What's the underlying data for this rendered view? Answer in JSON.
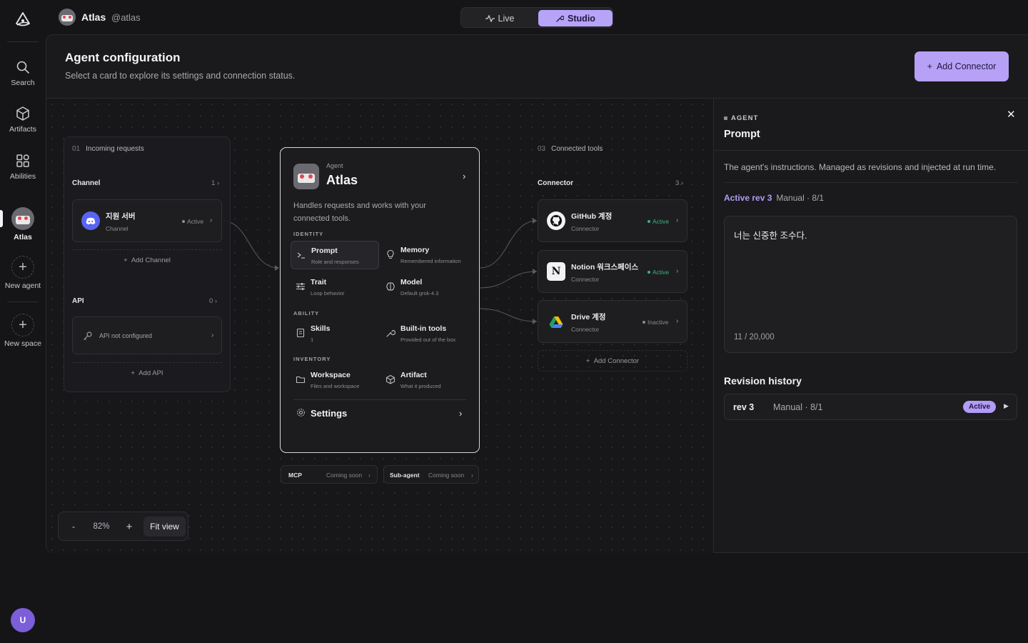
{
  "app": {
    "name": "Atlas",
    "handle": "@atlas"
  },
  "modes": {
    "live": "Live",
    "studio": "Studio",
    "selected": "Studio"
  },
  "rail": {
    "items": [
      {
        "label": "Search",
        "icon": "search-icon"
      },
      {
        "label": "Artifacts",
        "icon": "cube-icon"
      },
      {
        "label": "Abilities",
        "icon": "grid-icon"
      },
      {
        "label": "Atlas",
        "icon": "robot-avatar"
      },
      {
        "label": "New agent",
        "icon": "plus-icon"
      },
      {
        "label": "New space",
        "icon": "plus-icon"
      }
    ],
    "user_initial": "U"
  },
  "page": {
    "title": "Agent configuration",
    "subtitle": "Select a card to explore its settings and connection status.",
    "add_connector": "Add Connector"
  },
  "incoming": {
    "num": "01",
    "title": "Incoming requests",
    "channel_label": "Channel",
    "channel_count": "1",
    "channel_item": {
      "name": "지원 서버",
      "sub": "Channel",
      "status": "Active"
    },
    "add_channel": "Add Channel",
    "api_label": "API",
    "api_count": "0",
    "api_item": "API not configured",
    "add_api": "Add API"
  },
  "agent": {
    "kicker": "Agent",
    "name": "Atlas",
    "description": "Handles requests and works with your connected tools.",
    "sections": {
      "identity": "IDENTITY",
      "ability": "ABILITY",
      "inventory": "INVENTORY"
    },
    "features": {
      "prompt": {
        "name": "Prompt",
        "sub": "Role and responses"
      },
      "memory": {
        "name": "Memory",
        "sub": "Remembered information"
      },
      "trait": {
        "name": "Trait",
        "sub": "Loop behavior"
      },
      "model": {
        "name": "Model",
        "sub": "Default grok-4.3"
      },
      "skills": {
        "name": "Skills",
        "sub": "1"
      },
      "builtin": {
        "name": "Built-in tools",
        "sub": "Provided out of the box"
      },
      "workspace": {
        "name": "Workspace",
        "sub": "Files and workspace"
      },
      "artifact": {
        "name": "Artifact",
        "sub": "What it produced"
      }
    },
    "settings": "Settings"
  },
  "pills": {
    "mcp": {
      "name": "MCP",
      "status": "Coming soon"
    },
    "subagent": {
      "name": "Sub-agent",
      "status": "Coming soon"
    }
  },
  "tools": {
    "num": "03",
    "title": "Connected tools",
    "connector_label": "Connector",
    "connector_count": "3",
    "items": [
      {
        "name": "GitHub 계정",
        "sub": "Connector",
        "status": "Active",
        "icon": "github-icon"
      },
      {
        "name": "Notion 워크스페이스",
        "sub": "Connector",
        "status": "Active",
        "icon": "notion-icon"
      },
      {
        "name": "Drive 계정",
        "sub": "Connector",
        "status": "Inactive",
        "icon": "drive-icon"
      }
    ],
    "add_connector": "Add Connector"
  },
  "zoom": {
    "minus": "-",
    "level": "82%",
    "plus": "+",
    "fit": "Fit view"
  },
  "panel": {
    "kicker": "AGENT",
    "title": "Prompt",
    "description": "The agent's instructions. Managed as revisions and injected at run time.",
    "active_rev": "Active rev 3",
    "rev_meta": "Manual · 8/1",
    "prompt_text": "너는 신중한 조수다.",
    "char_count": "11 / 20,000",
    "history_title": "Revision history",
    "history": [
      {
        "rev": "rev 3",
        "meta": "Manual · 8/1",
        "badge": "Active"
      }
    ]
  },
  "colors": {
    "accent": "#b6a1f6",
    "active": "#3fb07a",
    "inactive": "#8a8a90",
    "danger": "#e2484f"
  }
}
